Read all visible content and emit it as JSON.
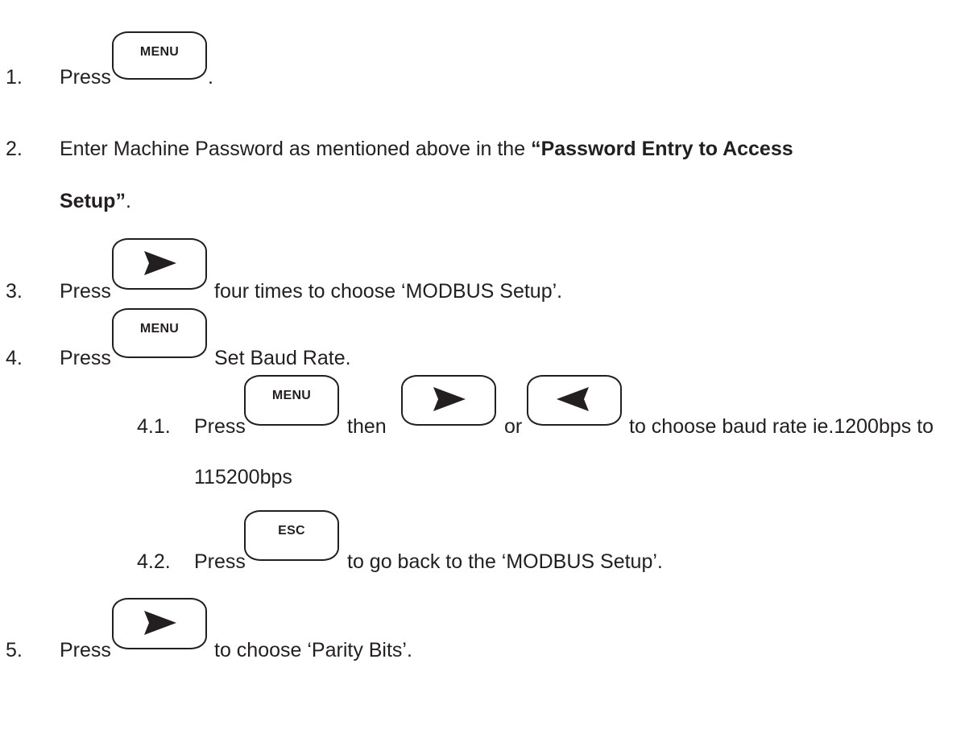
{
  "steps": [
    {
      "num": "1.",
      "press": "Press",
      "key_label": "MENU",
      "after": "."
    },
    {
      "num": "2.",
      "text_before": "Enter Machine Password as mentioned above in the ",
      "bold_line1": "“Password Entry to Access",
      "bold_line2": "Setup”",
      "after": "."
    },
    {
      "num": "3.",
      "press": "Press",
      "after": "four times to choose ‘MODBUS Setup’."
    },
    {
      "num": "4.",
      "press": "Press",
      "key_label": "MENU",
      "after": "Set Baud Rate."
    },
    {
      "num": "4.1.",
      "press": "Press",
      "key_label": "MENU",
      "then": "then",
      "or": "or",
      "after": "to choose baud rate ie.1200bps to",
      "line2": "115200bps"
    },
    {
      "num": "4.2.",
      "press": "Press",
      "key_label": "ESC",
      "after": "to go back to the ‘MODBUS Setup’."
    },
    {
      "num": "5.",
      "press": "Press",
      "after": "to choose ‘Parity Bits’."
    }
  ],
  "icons": {
    "right_arrow": "right-arrow-key-icon",
    "left_arrow": "left-arrow-key-icon"
  },
  "colors": {
    "text": "#231f20",
    "background": "#ffffff"
  }
}
